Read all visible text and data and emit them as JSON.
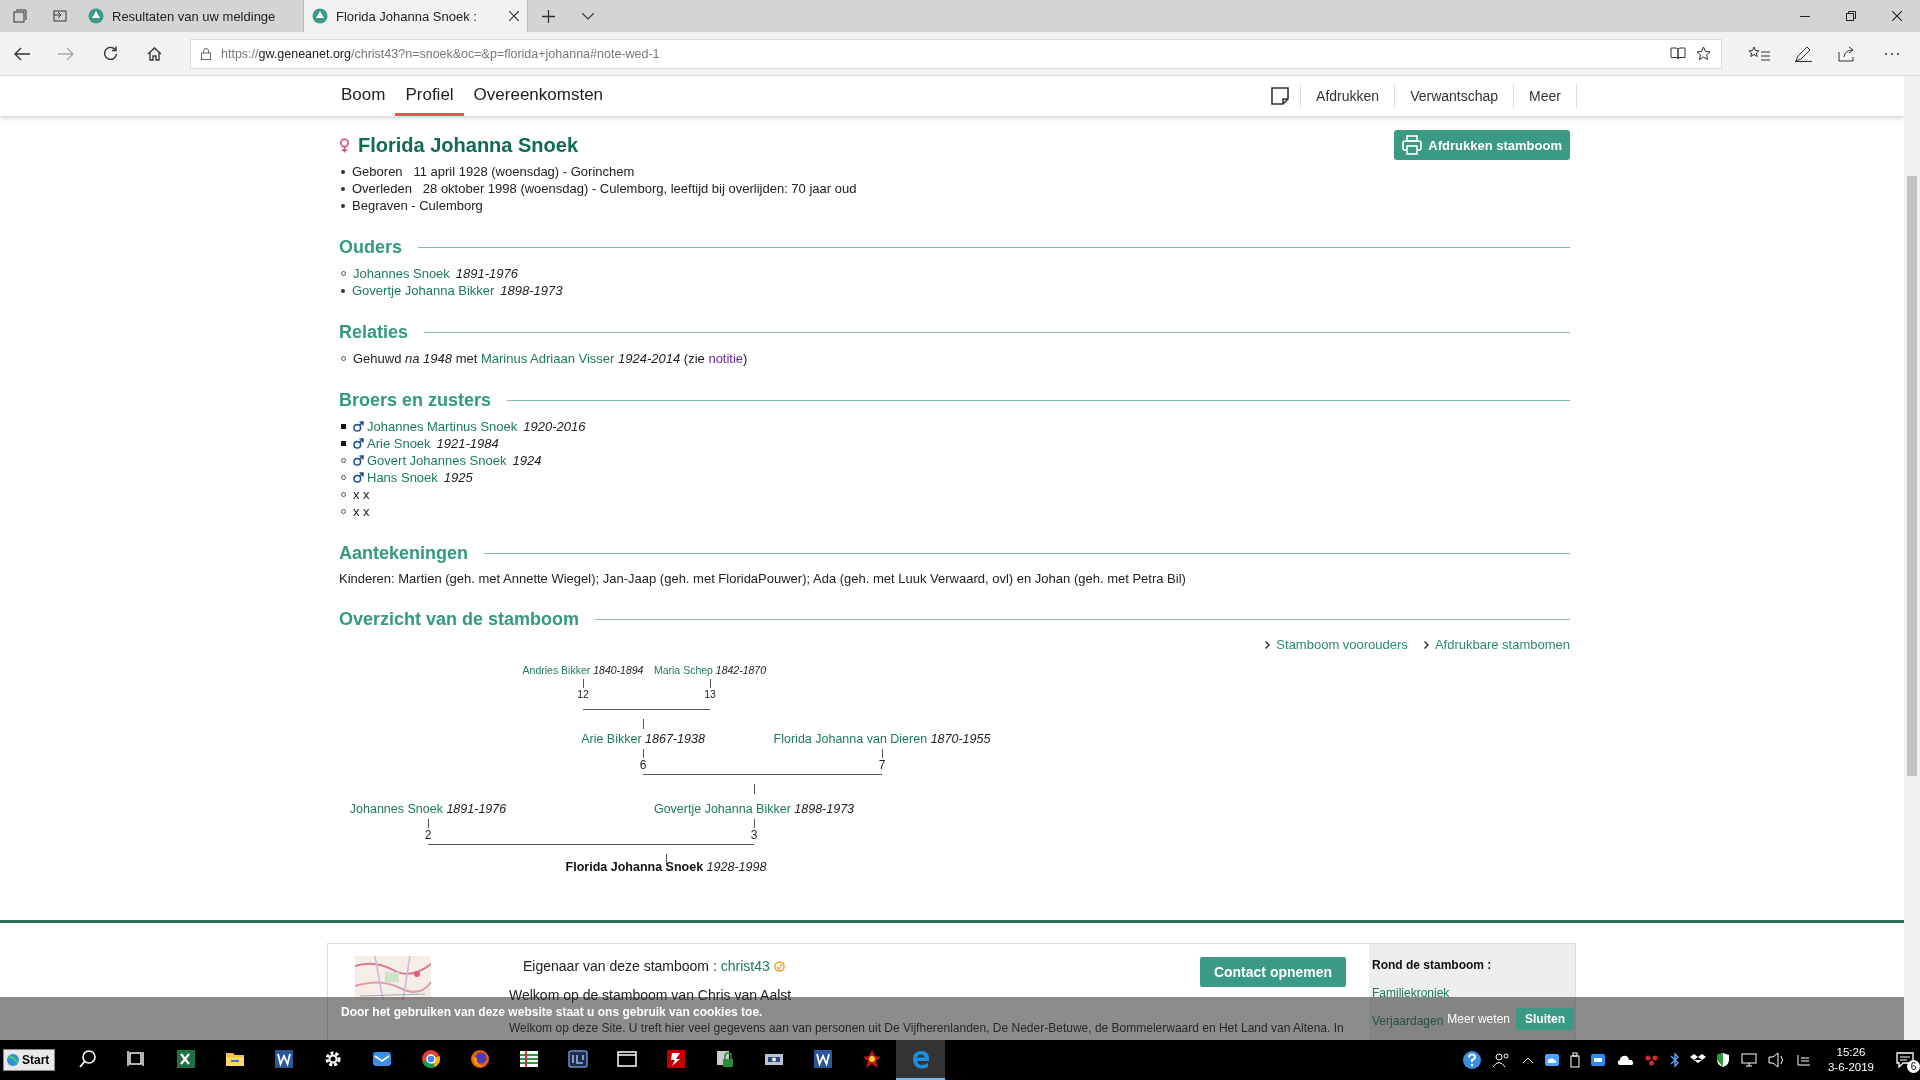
{
  "browser": {
    "tabs": [
      {
        "title": "Resultaten van uw meldinge",
        "selected": false
      },
      {
        "title": "Florida Johanna Snoek :",
        "selected": true
      }
    ],
    "url_scheme": "https://",
    "url_host": "gw.geneanet.org",
    "url_path": "/christ43?n=snoek&oc=&p=florida+johanna#note-wed-1"
  },
  "site_nav": {
    "tabs": [
      {
        "label": "Boom",
        "selected": false
      },
      {
        "label": "Profiel",
        "selected": true
      },
      {
        "label": "Overeenkomsten",
        "selected": false
      }
    ],
    "actions": [
      "Afdrukken",
      "Verwantschap",
      "Meer"
    ]
  },
  "person": {
    "female": true,
    "name": "Florida Johanna Snoek",
    "print_button": "Afdrukken stamboom",
    "facts": [
      "Geboren   11 april 1928 (woensdag) - Gorinchem",
      "Overleden   28 oktober 1998 (woensdag) - Culemborg, leeftijd bij overlijden: 70 jaar oud",
      "Begraven - Culemborg"
    ]
  },
  "parents": {
    "title": "Ouders",
    "items": [
      {
        "name": "Johannes Snoek",
        "years": "1891-1976",
        "filled": false
      },
      {
        "name": "Govertje Johanna Bikker",
        "years": "1898-1973",
        "filled": true
      }
    ]
  },
  "relations": {
    "title": "Relaties",
    "items": [
      {
        "filled": false,
        "prefix": "Gehuwd *na 1948* met",
        "partner": "Marinus Adriaan Visser",
        "years": "1924-2014",
        "note_open": "(zie",
        "note_link": "notitie",
        "note_close": ")"
      }
    ]
  },
  "siblings": {
    "title": "Broers en zusters",
    "items": [
      {
        "filled": true,
        "male": true,
        "name": "Johannes Martinus Snoek",
        "years": "1920-2016"
      },
      {
        "filled": true,
        "male": true,
        "name": "Arie Snoek",
        "years": "1921-1984"
      },
      {
        "filled": false,
        "male": true,
        "name": "Govert Johannes Snoek",
        "years": "1924"
      },
      {
        "filled": false,
        "male": true,
        "name": "Hans Snoek",
        "years": "1925"
      },
      {
        "filled": false,
        "text": "x x"
      },
      {
        "filled": false,
        "text": "x x"
      }
    ]
  },
  "notes": {
    "title": "Aantekeningen",
    "text": "Kinderen: Martien (geh. met Annette Wiegel); Jan-Jaap (geh. met FloridaPouwer); Ada (geh. met Luuk Verwaard, ovl) en Johan (geh. met Petra Bil)"
  },
  "overview": {
    "title": "Overzicht van de stamboom",
    "links": [
      "Stamboom voorouders",
      "Afdrukbare stambomen"
    ],
    "tree": {
      "name": "Florida Johanna Snoek",
      "years": "1928-1998",
      "father": {
        "name": "Johannes Snoek",
        "years": "1891-1976",
        "number": "2"
      },
      "mother": {
        "name": "Govertje Johanna Bikker",
        "years": "1898-1973",
        "number": "3",
        "father": {
          "name": "Arie Bikker",
          "years": "1867-1938",
          "number": "6",
          "father": {
            "name": "Andries Bikker",
            "years": "1840-1894",
            "number": "12"
          },
          "mother": {
            "name": "Maria Schep",
            "years": "1842-1870",
            "number": "13"
          }
        },
        "mother": {
          "name": "Florida Johanna van Dieren",
          "years": "1870-1955",
          "number": "7"
        }
      }
    }
  },
  "footer": {
    "owner_label": "Eigenaar van deze stamboom :",
    "owner": "christ43",
    "contact_button": "Contact opnemen",
    "welcome_title": "Welkom op de stamboom van Chris van Aalst",
    "welcome_text": "Welkom op deze Site. U treft hier veel gegevens aan van personen uit De Vijfherenlanden, De Neder-Betuwe, de Bommelerwaard en Het Land van Altena. In",
    "side_title": "Rond de stamboom :",
    "side_links": [
      "Familiekroniek",
      "Verjaardagen"
    ]
  },
  "cookie_bar": {
    "text": "Door het gebruiken van deze website staat u ons gebruik van cookies toe.",
    "more": "Meer weten",
    "close": "Sluiten"
  },
  "taskbar": {
    "start": "Start",
    "apps": [
      {
        "kind": "search",
        "selected": false
      },
      {
        "kind": "taskview",
        "selected": false
      },
      {
        "kind": "excel",
        "selected": false
      },
      {
        "kind": "folder",
        "selected": false
      },
      {
        "kind": "word",
        "selected": false
      },
      {
        "kind": "gear",
        "selected": false
      },
      {
        "kind": "mail",
        "selected": false
      },
      {
        "kind": "chrome",
        "selected": false
      },
      {
        "kind": "firefox",
        "selected": false
      },
      {
        "kind": "sheet",
        "selected": false
      },
      {
        "kind": "box",
        "selected": false
      },
      {
        "kind": "window",
        "selected": false
      },
      {
        "kind": "ftp",
        "selected": false
      },
      {
        "kind": "lock",
        "selected": false
      },
      {
        "kind": "scanner",
        "selected": false
      },
      {
        "kind": "word",
        "selected": false
      },
      {
        "kind": "game",
        "selected": false
      },
      {
        "kind": "edge",
        "selected": true
      }
    ],
    "time": "15:26",
    "date": "3-6-2019",
    "notifications": "6"
  }
}
